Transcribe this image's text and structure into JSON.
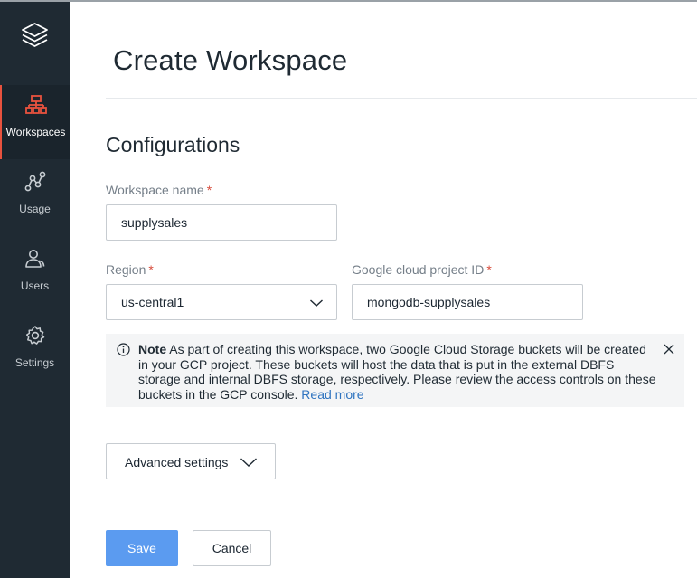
{
  "sidebar": {
    "logo_icon": "layers-icon",
    "items": [
      {
        "label": "Workspaces",
        "icon": "workspaces-icon",
        "active": true
      },
      {
        "label": "Usage",
        "icon": "usage-icon",
        "active": false
      },
      {
        "label": "Users",
        "icon": "users-icon",
        "active": false
      },
      {
        "label": "Settings",
        "icon": "gear-icon",
        "active": false
      }
    ]
  },
  "page": {
    "title": "Create Workspace"
  },
  "form": {
    "section_title": "Configurations",
    "required_marker": "*",
    "workspace_name": {
      "label": "Workspace name",
      "value": "supplysales"
    },
    "region": {
      "label": "Region",
      "value": "us-central1"
    },
    "gcp_project": {
      "label": "Google cloud project ID",
      "value": "mongodb-supplysales"
    }
  },
  "note": {
    "title": "Note",
    "text": "As part of creating this workspace, two Google Cloud Storage buckets will be created in your GCP project. These buckets will host the data that is put in the external DBFS storage and internal DBFS storage, respectively. Please review the access controls on these buckets in the GCP console.",
    "link": "Read more"
  },
  "buttons": {
    "advanced": "Advanced settings",
    "save": "Save",
    "cancel": "Cancel"
  },
  "colors": {
    "sidebar_bg": "#1f2a33",
    "accent_active": "#e8523e",
    "primary_button": "#5b9bf0",
    "link": "#2f74c0",
    "required": "#d74c3c"
  }
}
